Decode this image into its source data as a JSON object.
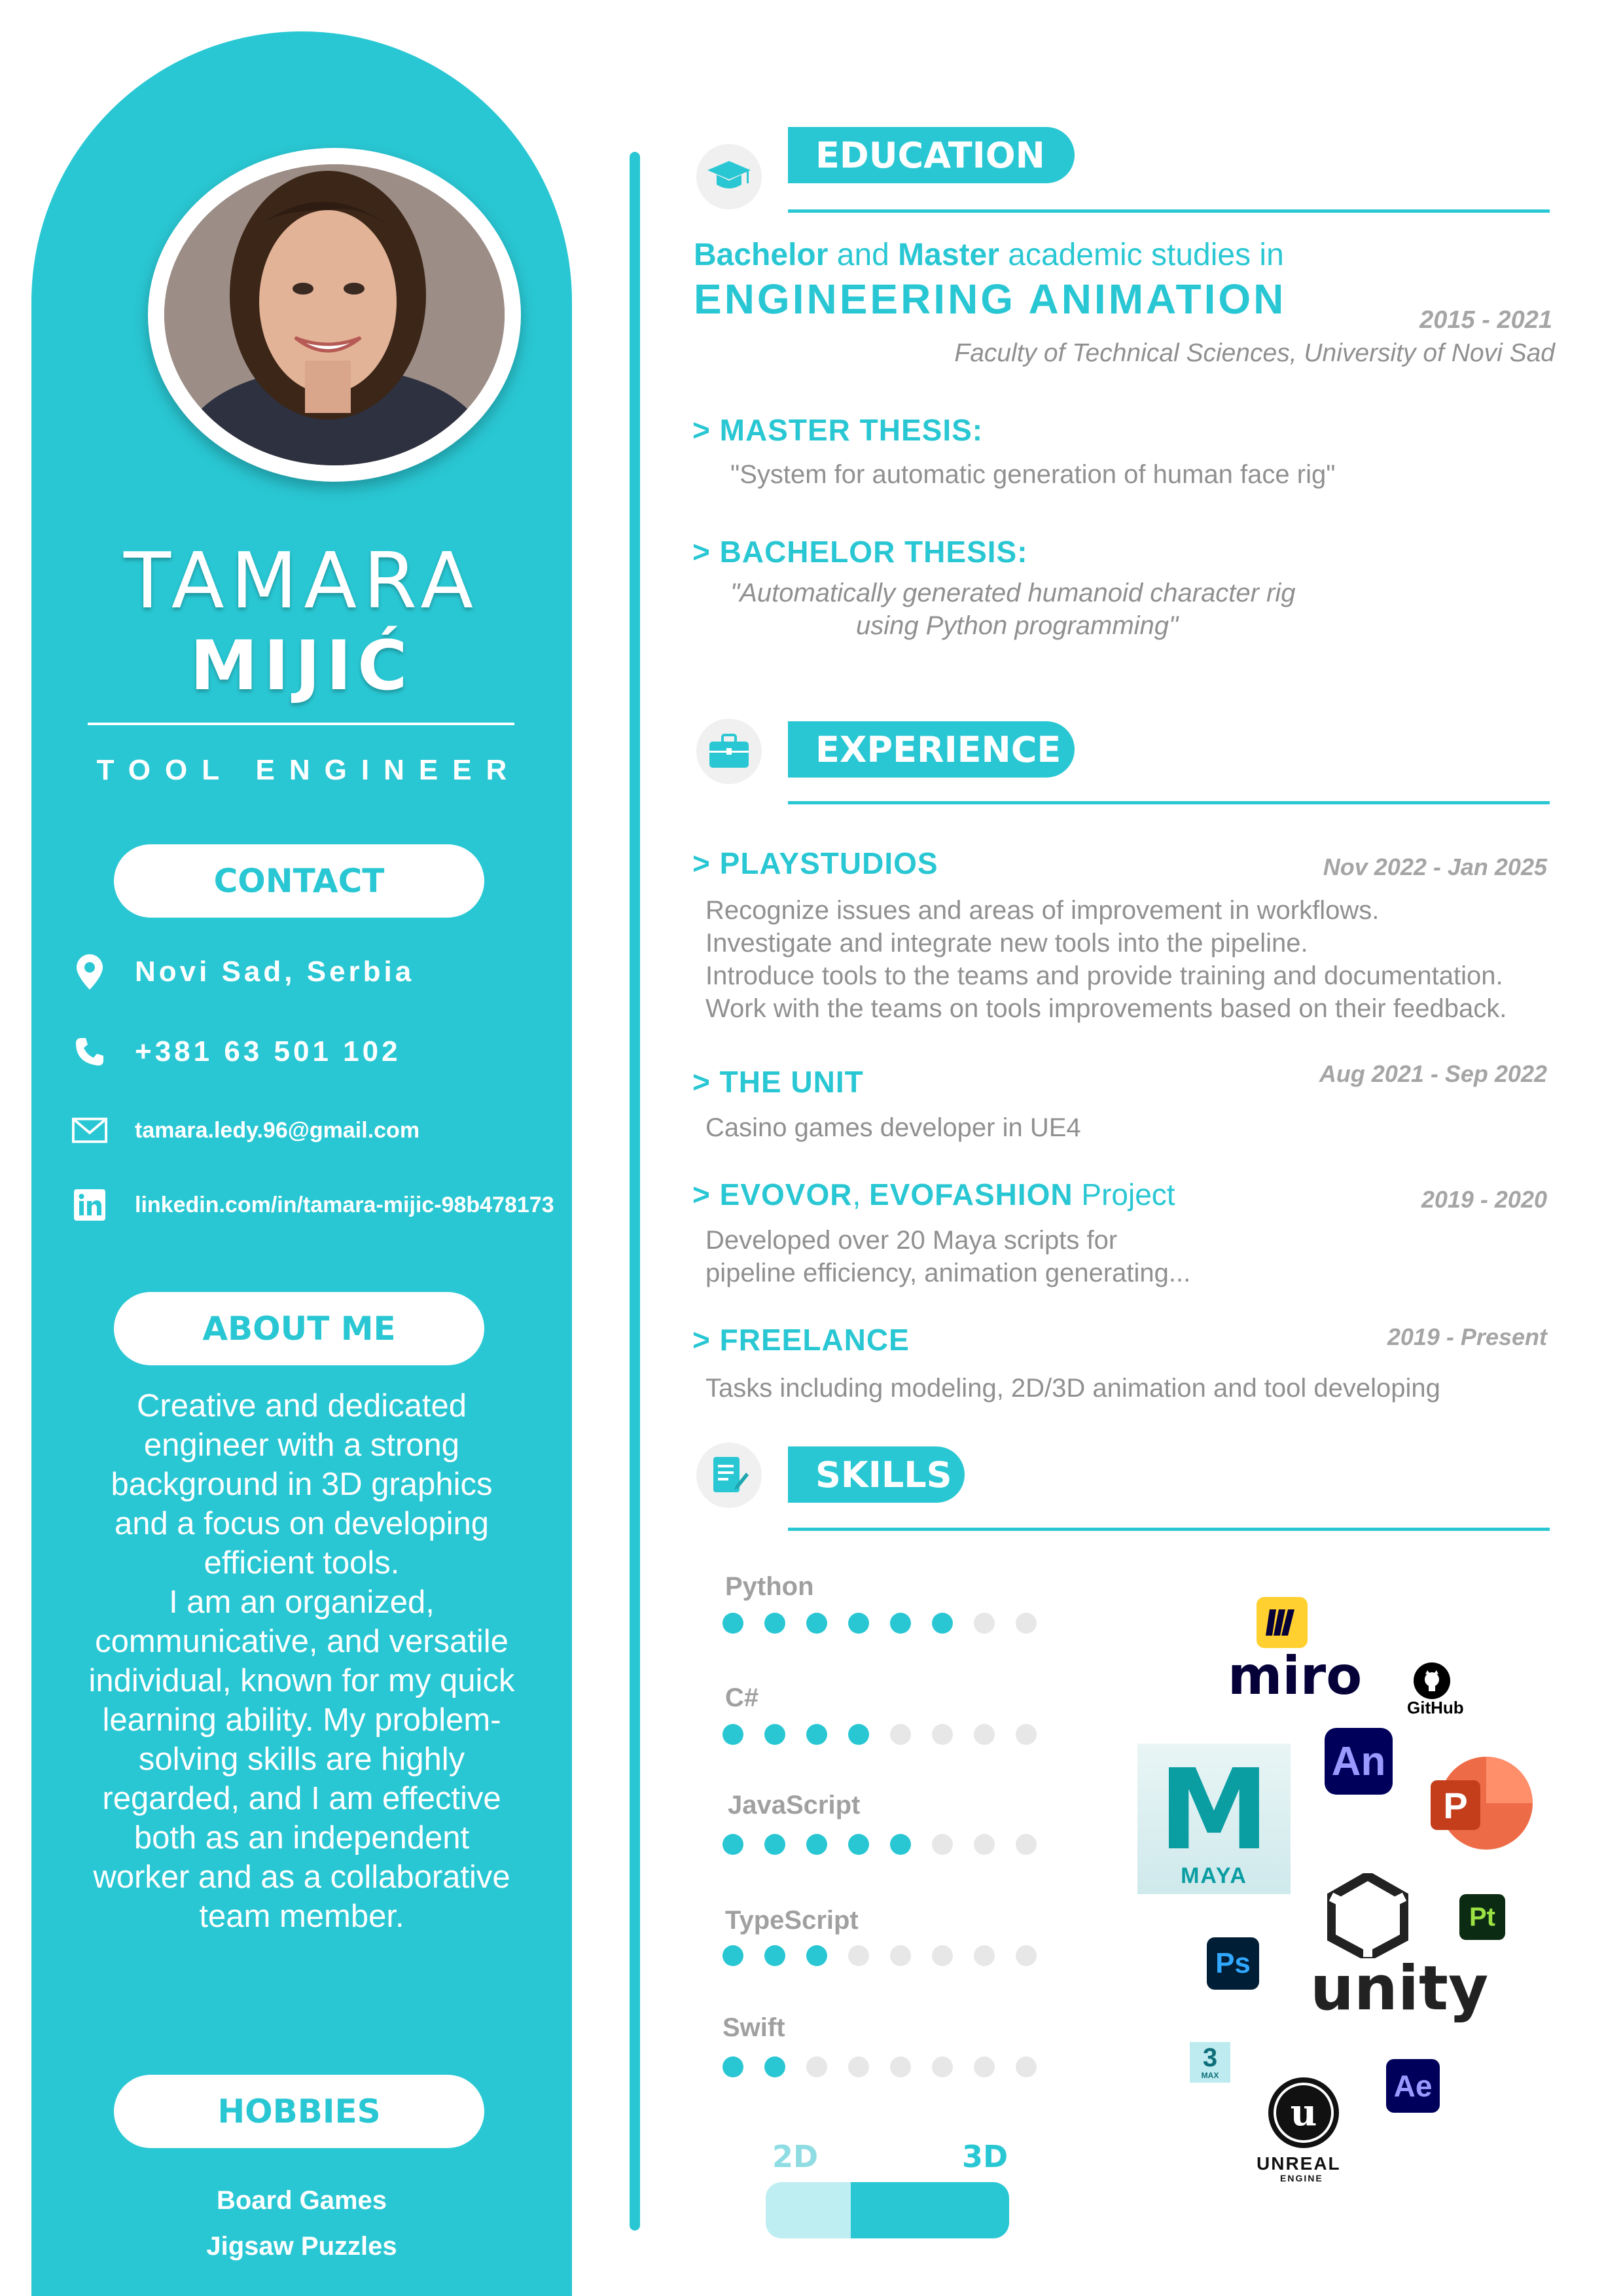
{
  "colors": {
    "accent": "#29c7d3",
    "text_gray": "#909090",
    "dot_off": "#e7e7e7"
  },
  "profile": {
    "first_name": "TAMARA",
    "last_name": "MIJIĆ",
    "title": "TOOL ENGINEER"
  },
  "contact": {
    "heading": "CONTACT",
    "location": "Novi Sad, Serbia",
    "phone": "+381 63 501 102",
    "email": "tamara.ledy.96@gmail.com",
    "linkedin": "linkedin.com/in/tamara-mijic-98b478173"
  },
  "about": {
    "heading": "ABOUT ME",
    "paragraph1": "Creative and dedicated engineer with a strong background in 3D graphics and a focus on developing efficient tools.",
    "paragraph2": "I am an organized, communicative, and versatile individual, known for my quick learning ability. My problem-solving skills are highly regarded, and I am effective both as an independent worker and as a collaborative team member."
  },
  "hobbies": {
    "heading": "HOBBIES",
    "items": [
      "Board Games",
      "Jigsaw Puzzles"
    ]
  },
  "education": {
    "heading": "EDUCATION",
    "degree_line_bachelor": "Bachelor",
    "degree_line_and": " and ",
    "degree_line_master": "Master",
    "degree_line_rest": " academic studies in",
    "field": "ENGINEERING ANIMATION",
    "dates": "2015 - 2021",
    "institution": "Faculty of Technical Sciences, University of Novi Sad",
    "master_thesis_label": ">  MASTER THESIS:",
    "master_thesis": "\"System for automatic generation of human face rig\"",
    "bachelor_thesis_label": ">  BACHELOR THESIS:",
    "bachelor_thesis_line1": "\"Automatically generated humanoid character rig",
    "bachelor_thesis_line2": "using Python programming\""
  },
  "experience": {
    "heading": "EXPERIENCE",
    "jobs": [
      {
        "company": "> PLAYSTUDIOS",
        "dates": "Nov 2022 - Jan 2025",
        "lines": [
          "Recognize issues and areas of improvement in workflows.",
          "Investigate and integrate new tools into the pipeline.",
          "Introduce tools to the teams and provide training and documentation.",
          "Work with the teams on tools improvements based on their feedback."
        ]
      },
      {
        "company": "> THE UNIT",
        "dates": "Aug 2021 - Sep 2022",
        "lines": [
          "Casino games developer in UE4"
        ]
      },
      {
        "company_a": "> EVOVOR",
        "company_sep": ", ",
        "company_b": "EVOFASHION",
        "company_c": " Project",
        "dates": "2019 - 2020",
        "lines": [
          "Developed over 20 Maya scripts for",
          "pipeline efficiency, animation generating..."
        ]
      },
      {
        "company": "> FREELANCE",
        "dates": "2019 - Present",
        "lines": [
          "Tasks including modeling, 2D/3D animation and tool developing"
        ]
      }
    ]
  },
  "skills": {
    "heading": "SKILLS",
    "list": [
      {
        "name": "Python",
        "level": 6,
        "max": 8
      },
      {
        "name": "C#",
        "level": 4,
        "max": 8
      },
      {
        "name": "JavaScript",
        "level": 5,
        "max": 8
      },
      {
        "name": "TypeScript",
        "level": 3,
        "max": 8
      },
      {
        "name": "Swift",
        "level": 2,
        "max": 8
      }
    ],
    "dimension": {
      "label_2d": "2D",
      "label_3d": "3D",
      "share_3d": 0.65
    },
    "tools": {
      "miro": "miro",
      "github": "GitHub",
      "animate": "An",
      "powerpoint": "P",
      "maya_letter": "M",
      "maya": "MAYA",
      "unity": "unity",
      "substance_painter": "Pt",
      "photoshop": "Ps",
      "max_num": "3",
      "max_sub": "MAX",
      "unreal": "UNREAL",
      "unreal_sub": "ENGINE",
      "after_effects": "Ae"
    }
  }
}
